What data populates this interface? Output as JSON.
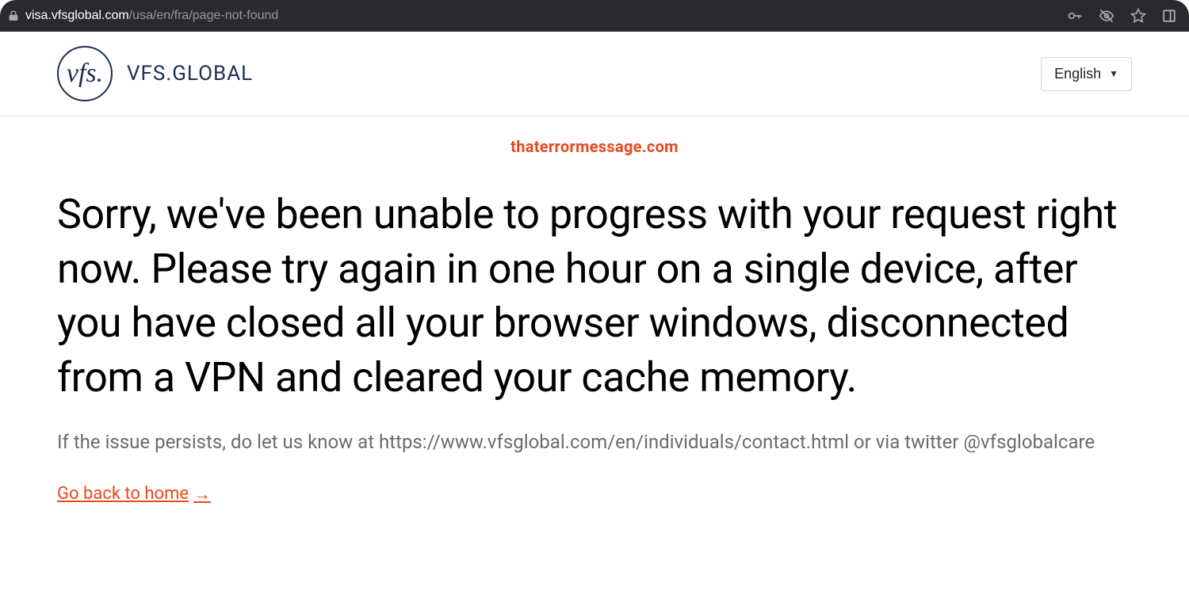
{
  "address_bar": {
    "domain": "visa.vfsglobal.com",
    "path": "/usa/en/fra/page-not-found"
  },
  "header": {
    "logo_script": "vfs.",
    "logo_text": "VFS.GLOBAL",
    "language_label": "English"
  },
  "watermark": "thaterrormessage.com",
  "main": {
    "heading": "Sorry, we've been unable to progress with your request right now. Please try again in one hour on a single device, after you have closed all your browser windows, disconnected from a VPN and cleared your cache memory.",
    "subtext": "If the issue persists, do let us know at https://www.vfsglobal.com/en/individuals/contact.html or via twitter @vfsglobalcare",
    "home_link_label": "Go back to home",
    "home_link_arrow": "→"
  }
}
